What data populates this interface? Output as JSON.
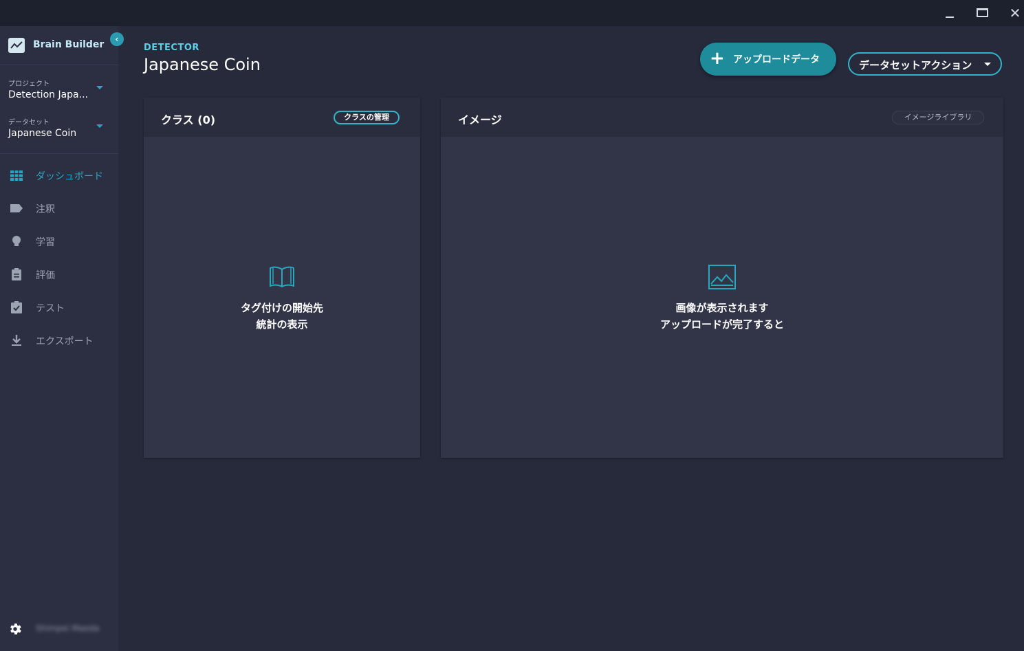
{
  "window": {
    "minimize": "_",
    "maximize": "□",
    "close": "✕"
  },
  "brand": {
    "name": "Brain Builder"
  },
  "sidebar": {
    "project": {
      "label": "プロジェクト",
      "value": "Detection Japa..."
    },
    "dataset": {
      "label": "データセット",
      "value": "Japanese Coin"
    },
    "items": [
      {
        "label": "ダッシュボード",
        "icon": "dashboard-grid-icon",
        "active": true
      },
      {
        "label": "注釈",
        "icon": "tag-icon",
        "active": false
      },
      {
        "label": "学習",
        "icon": "lightbulb-icon",
        "active": false
      },
      {
        "label": "評価",
        "icon": "clipboard-icon",
        "active": false
      },
      {
        "label": "テスト",
        "icon": "clipboard-check-icon",
        "active": false
      },
      {
        "label": "エクスポート",
        "icon": "download-icon",
        "active": false
      }
    ],
    "user": {
      "name": "Shimpei Maeda"
    }
  },
  "header": {
    "kicker": "DETECTOR",
    "title": "Japanese Coin",
    "upload_button": "アップロードデータ",
    "dataset_actions_button": "データセットアクション"
  },
  "cards": {
    "classes": {
      "title": "クラス (0)",
      "action": "クラスの管理",
      "empty_line1": "タグ付けの開始先",
      "empty_line2": "統計の表示"
    },
    "images": {
      "title": "イメージ",
      "action": "イメージライブラリ",
      "empty_line1": "画像が表示されます",
      "empty_line2": "アップロードが完了すると"
    }
  },
  "colors": {
    "accent": "#2aa7c0",
    "background": "#262a3b",
    "sidebar": "#2b2f41",
    "card": "#323548"
  }
}
